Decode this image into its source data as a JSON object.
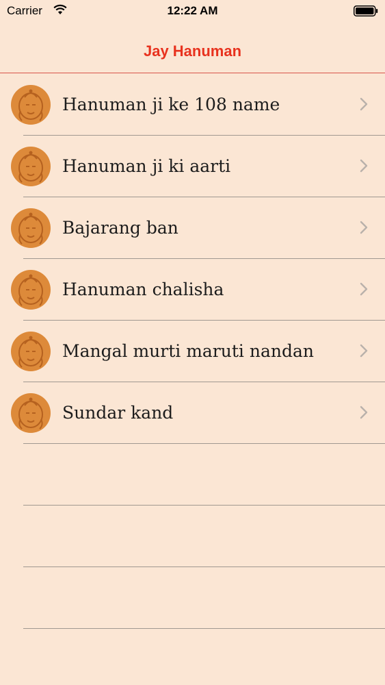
{
  "status": {
    "carrier": "Carrier",
    "time": "12:22 AM"
  },
  "nav": {
    "title": "Jay Hanuman"
  },
  "items": [
    {
      "label": "Hanuman ji ke 108 name"
    },
    {
      "label": "Hanuman ji ki aarti"
    },
    {
      "label": "Bajarang ban"
    },
    {
      "label": "Hanuman chalisha"
    },
    {
      "label": "Mangal murti maruti nandan"
    },
    {
      "label": "Sundar kand"
    }
  ],
  "colors": {
    "accent": "#e8321e",
    "icon_bg": "#dd8a3a",
    "background": "#fbe6d4"
  },
  "icons": {
    "row_icon": "hanuman-icon",
    "disclosure": "chevron-right-icon"
  }
}
